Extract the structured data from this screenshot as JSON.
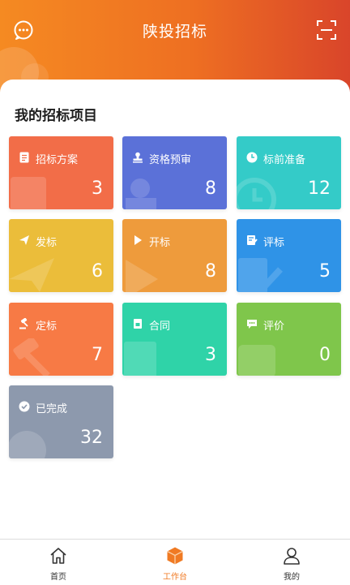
{
  "header": {
    "title": "陕投招标",
    "left_icon": "message-icon",
    "right_icon": "scan-icon"
  },
  "section": {
    "title": "我的招标项目"
  },
  "cards": [
    {
      "label": "招标方案",
      "count": "3",
      "color": "#f26d48",
      "icon": "document-icon"
    },
    {
      "label": "资格预审",
      "count": "8",
      "color": "#5b71d8",
      "icon": "stamp-icon"
    },
    {
      "label": "标前准备",
      "count": "12",
      "color": "#34cbc8",
      "icon": "clock-icon"
    },
    {
      "label": "发标",
      "count": "6",
      "color": "#ebbd3a",
      "icon": "paper-plane-icon"
    },
    {
      "label": "开标",
      "count": "8",
      "color": "#ee9b3c",
      "icon": "play-icon"
    },
    {
      "label": "评标",
      "count": "5",
      "color": "#2f93e7",
      "icon": "edit-note-icon"
    },
    {
      "label": "定标",
      "count": "7",
      "color": "#f77a45",
      "icon": "gavel-icon"
    },
    {
      "label": "合同",
      "count": "3",
      "color": "#2fd3a8",
      "icon": "contract-icon"
    },
    {
      "label": "评价",
      "count": "0",
      "color": "#7fc64b",
      "icon": "comment-icon"
    },
    {
      "label": "已完成",
      "count": "32",
      "color": "#8d99ad",
      "icon": "check-circle-icon"
    }
  ],
  "tabbar": {
    "tabs": [
      {
        "label": "首页",
        "icon": "home-icon"
      },
      {
        "label": "工作台",
        "icon": "workbench-icon",
        "active": true
      },
      {
        "label": "我的",
        "icon": "person-icon"
      }
    ],
    "active_color": "#f07a23"
  }
}
